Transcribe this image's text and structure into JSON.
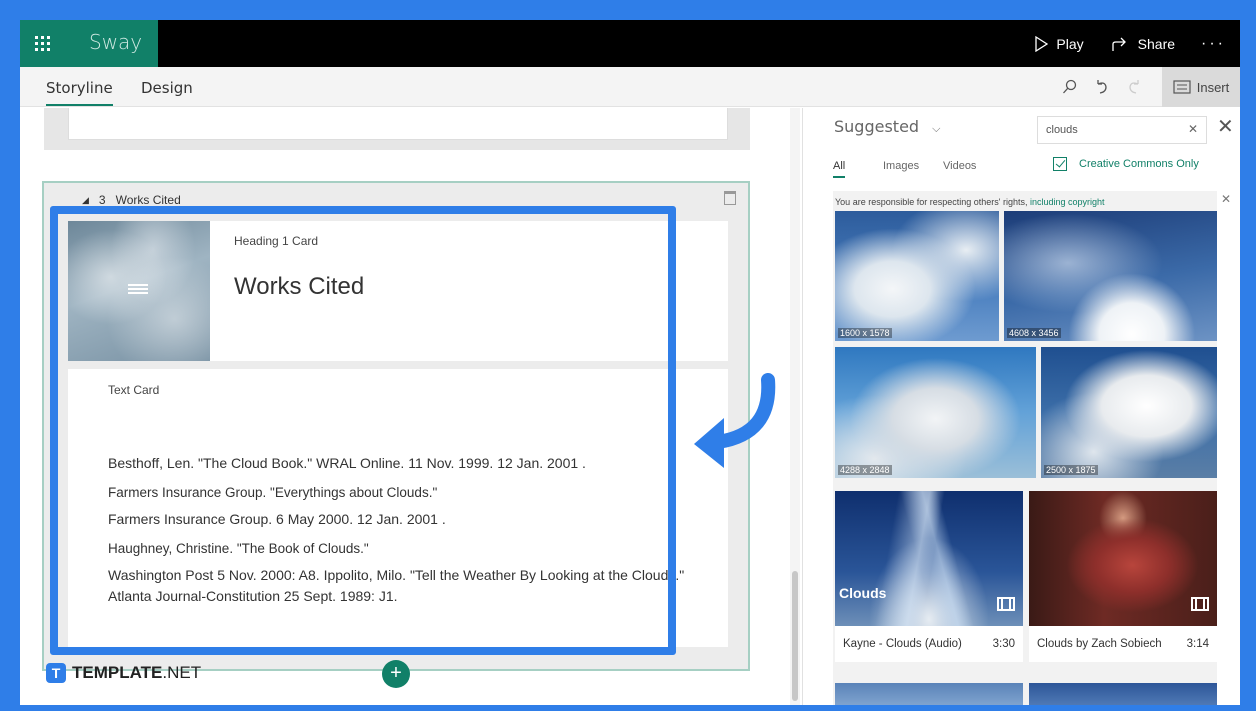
{
  "app": {
    "name": "Sway"
  },
  "top_actions": {
    "play": "Play",
    "share": "Share",
    "more": "···"
  },
  "tabs": [
    {
      "label": "Storyline"
    },
    {
      "label": "Design"
    }
  ],
  "toolbar": {
    "insert": "Insert"
  },
  "section": {
    "number": "3",
    "title": "Works Cited"
  },
  "heading_card": {
    "type": "Heading 1 Card",
    "title": "Works Cited"
  },
  "text_card": {
    "type": "Text Card",
    "citations": [
      "Besthoff, Len. \"The Cloud Book.\" WRAL Online. 11 Nov. 1999. 12 Jan. 2001 .",
      "Farmers Insurance Group. \"Everythings about Clouds.\"",
      "Farmers Insurance Group. 6 May 2000. 12 Jan. 2001 .",
      "Haughney, Christine. \"The Book of Clouds.\"",
      "Washington Post 5 Nov. 2000: A8. Ippolito, Milo. \"Tell the Weather By Looking at the Clouds.\" Atlanta Journal-Constitution 25 Sept. 1989: J1."
    ]
  },
  "add_button": "+",
  "watermark": {
    "brand_bold": "TEMPLATE",
    "brand_suffix": ".NET",
    "mark": "T"
  },
  "panel": {
    "dropdown_label": "Suggested",
    "search_value": "clouds",
    "filters": [
      "All",
      "Images",
      "Videos"
    ],
    "creative_commons": "Creative Commons Only",
    "notice": "You are responsible for respecting others' rights, ",
    "notice_link": "including copyright",
    "images": [
      {
        "size": "1600 x 1578"
      },
      {
        "size": "4608 x 3456"
      },
      {
        "size": "4288 x 2848"
      },
      {
        "size": "2500 x 1875"
      }
    ],
    "videos": [
      {
        "overlay_title": "Clouds",
        "caption": "Kayne - Clouds (Audio)",
        "duration": "3:30"
      },
      {
        "caption": "Clouds by Zach Sobiech",
        "duration": "3:14"
      }
    ]
  },
  "colors": {
    "brand": "#118068",
    "highlight": "#2f7ee8",
    "topbar": "#000000"
  }
}
